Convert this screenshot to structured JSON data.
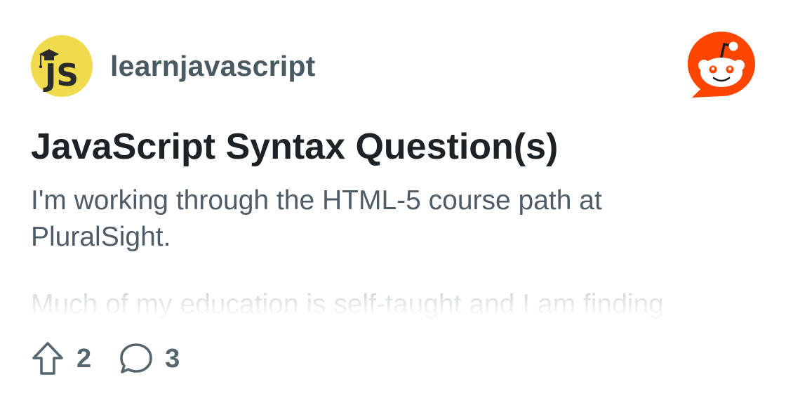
{
  "subreddit": {
    "name": "learnjavascript",
    "avatar_icon": "js-graduation-cap-icon",
    "avatar_text": "JS",
    "avatar_color": "#f0db4f"
  },
  "brand": {
    "logo_icon": "reddit-snoo-icon",
    "logo_color": "#ff4500"
  },
  "post": {
    "title": "JavaScript Syntax Question(s)",
    "body_paragraphs": [
      "I'm working through the HTML-5 course path at PluralSight.",
      "Much of my education is self-taught and I am finding"
    ]
  },
  "actions": {
    "upvote_icon": "upvote-arrow-icon",
    "upvotes": "2",
    "comment_icon": "comment-bubble-icon",
    "comments": "3"
  }
}
